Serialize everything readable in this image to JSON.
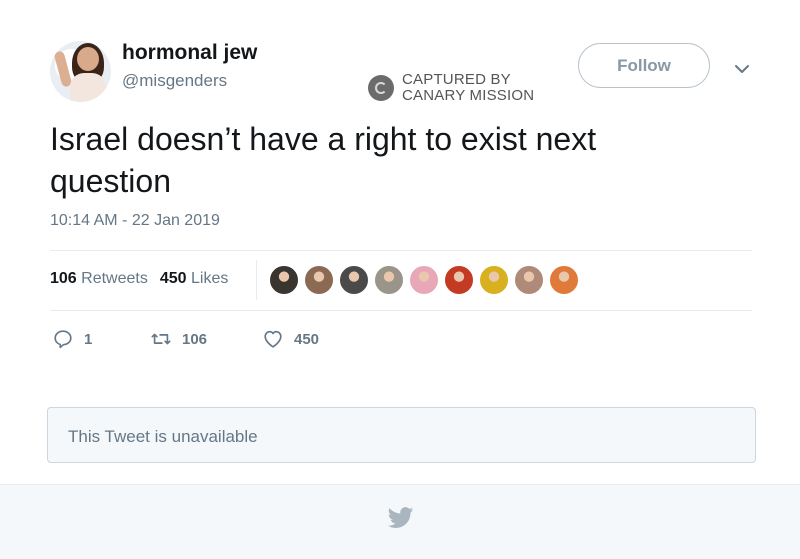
{
  "author": {
    "display_name": "hormonal jew",
    "handle": "@misgenders",
    "follow_label": "Follow"
  },
  "watermark": {
    "line1": "CAPTURED BY",
    "line2": "CANARY MISSION"
  },
  "tweet": {
    "text": "Israel doesn’t have a right to exist next question",
    "timestamp": "10:14 AM - 22 Jan 2019"
  },
  "stats": {
    "retweets_count": "106",
    "retweets_label": "Retweets",
    "likes_count": "450",
    "likes_label": "Likes"
  },
  "likers": [
    {
      "color": "#3b3530"
    },
    {
      "color": "#8a6a52"
    },
    {
      "color": "#4a4a4a"
    },
    {
      "color": "#9b9488"
    },
    {
      "color": "#e8a8b8"
    },
    {
      "color": "#c23b22"
    },
    {
      "color": "#d8b020"
    },
    {
      "color": "#b08a78"
    },
    {
      "color": "#e07a3a"
    }
  ],
  "actions": {
    "reply_count": "1",
    "retweet_count": "106",
    "like_count": "450"
  },
  "quoted": {
    "text": "This Tweet is unavailable"
  }
}
